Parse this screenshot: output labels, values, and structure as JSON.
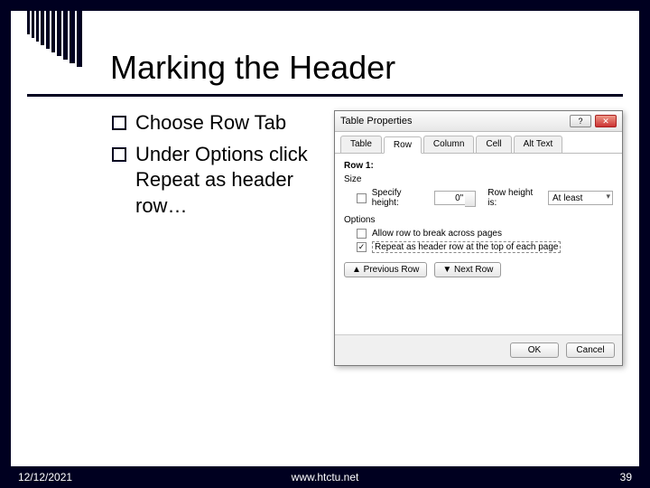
{
  "slide": {
    "title": "Marking the Header",
    "bullets": [
      "Choose Row Tab",
      "Under Options click Repeat as header row…"
    ]
  },
  "dialog": {
    "title": "Table Properties",
    "tabs": [
      "Table",
      "Row",
      "Column",
      "Cell",
      "Alt Text"
    ],
    "active_tab": "Row",
    "row_label": "Row 1:",
    "size_group": "Size",
    "specify_height_label": "Specify height:",
    "specify_height_value": "0\"",
    "row_height_is_label": "Row height is:",
    "row_height_is_value": "At least",
    "options_group": "Options",
    "allow_break_label": "Allow row to break across pages",
    "repeat_header_label": "Repeat as header row at the top of each page",
    "prev_btn": "▲ Previous Row",
    "next_btn": "▼ Next Row",
    "ok": "OK",
    "cancel": "Cancel",
    "help_btn": "?",
    "close_btn": "✕"
  },
  "footer": {
    "date": "12/12/2021",
    "url": "www.htctu.net",
    "page": "39"
  }
}
